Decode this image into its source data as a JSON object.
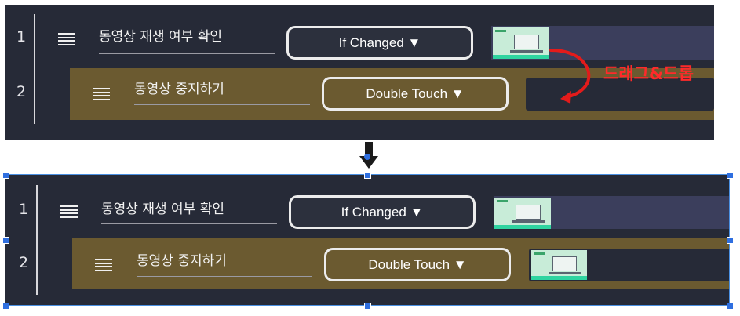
{
  "colors": {
    "panel_bg": "#262a37",
    "row_highlight": "#6b5a30",
    "arrow_red": "#e31b1b",
    "selection_blue": "#2f6fe0"
  },
  "before": {
    "rows": [
      {
        "number": "1",
        "label": "동영상 재생 여부 확인",
        "trigger": "If Changed ▼",
        "thumbnail": "video-thumbnail"
      },
      {
        "number": "2",
        "label": "동영상 중지하기",
        "trigger": "Double Touch ▼",
        "thumbnail": ""
      }
    ],
    "drag_annotation": "드래그&드롭"
  },
  "transition_arrow": "down-arrow-icon",
  "after": {
    "rows": [
      {
        "number": "1",
        "label": "동영상 재생 여부 확인",
        "trigger": "If Changed ▼",
        "thumbnail": "video-thumbnail"
      },
      {
        "number": "2",
        "label": "동영상 중지하기",
        "trigger": "Double Touch ▼",
        "thumbnail": "video-thumbnail"
      }
    ]
  }
}
